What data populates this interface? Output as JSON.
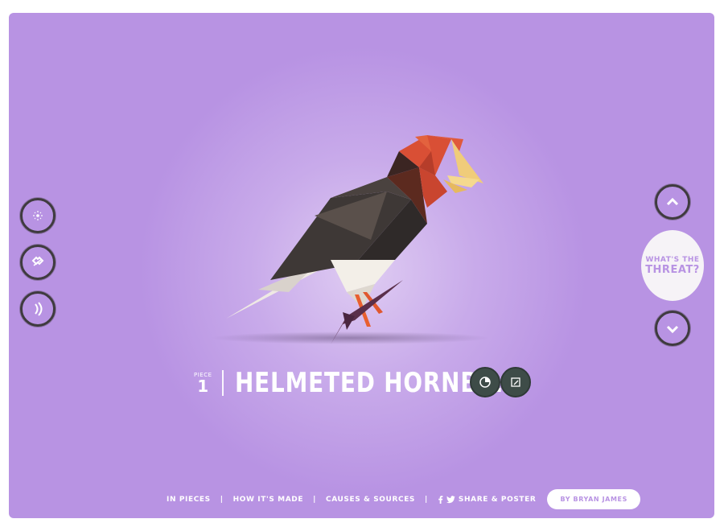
{
  "colors": {
    "background": "#b893e3",
    "dark_button": "#3f3b3f",
    "teal_button": "#3e4c48",
    "white": "#ffffff"
  },
  "left_controls": [
    {
      "icon": "dots-icon",
      "label": ""
    },
    {
      "icon": "shuffle-icon",
      "label": ""
    },
    {
      "icon": "sound-icon",
      "label": ""
    }
  ],
  "right_controls": {
    "up_icon": "chevron-up-icon",
    "down_icon": "chevron-down-icon",
    "threat_line1": "WHAT'S THE",
    "threat_line2": "THREAT?"
  },
  "species": {
    "piece_label": "PIECE",
    "piece_number": "1",
    "name": "HELMETED HORNBILL",
    "action_icons": [
      "clock-icon",
      "edit-icon"
    ]
  },
  "footer": {
    "links": [
      "IN PIECES",
      "HOW IT'S MADE",
      "CAUSES & SOURCES"
    ],
    "separator": "|",
    "share_label": "SHARE & POSTER",
    "byline": "BY BRYAN JAMES"
  }
}
